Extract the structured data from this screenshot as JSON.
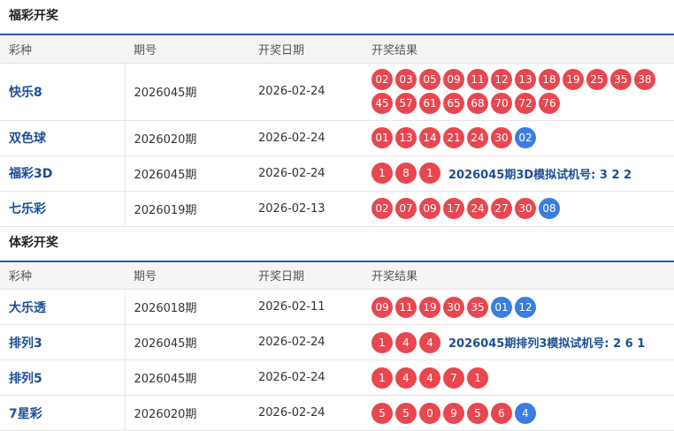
{
  "colors": {
    "red_ball": "#e8474f",
    "blue_ball": "#3a7ee0",
    "link": "#1d4e96",
    "header_border": "#2a5ba3"
  },
  "sections": [
    {
      "title": "福彩开奖",
      "headers": [
        "彩种",
        "期号",
        "开奖日期",
        "开奖结果"
      ],
      "rows": [
        {
          "name": "快乐8",
          "issue": "2026045期",
          "date": "2026-02-24",
          "balls": [
            {
              "n": "02",
              "c": "red"
            },
            {
              "n": "03",
              "c": "red"
            },
            {
              "n": "05",
              "c": "red"
            },
            {
              "n": "09",
              "c": "red"
            },
            {
              "n": "11",
              "c": "red"
            },
            {
              "n": "12",
              "c": "red"
            },
            {
              "n": "13",
              "c": "red"
            },
            {
              "n": "18",
              "c": "red"
            },
            {
              "n": "19",
              "c": "red"
            },
            {
              "n": "25",
              "c": "red"
            },
            {
              "n": "35",
              "c": "red"
            },
            {
              "n": "38",
              "c": "red"
            },
            {
              "n": "45",
              "c": "red"
            },
            {
              "n": "57",
              "c": "red"
            },
            {
              "n": "61",
              "c": "red"
            },
            {
              "n": "65",
              "c": "red"
            },
            {
              "n": "68",
              "c": "red"
            },
            {
              "n": "70",
              "c": "red"
            },
            {
              "n": "72",
              "c": "red"
            },
            {
              "n": "76",
              "c": "red"
            }
          ],
          "sim": ""
        },
        {
          "name": "双色球",
          "issue": "2026020期",
          "date": "2026-02-24",
          "balls": [
            {
              "n": "01",
              "c": "red"
            },
            {
              "n": "13",
              "c": "red"
            },
            {
              "n": "14",
              "c": "red"
            },
            {
              "n": "21",
              "c": "red"
            },
            {
              "n": "24",
              "c": "red"
            },
            {
              "n": "30",
              "c": "red"
            },
            {
              "n": "02",
              "c": "blue"
            }
          ],
          "sim": ""
        },
        {
          "name": "福彩3D",
          "issue": "2026045期",
          "date": "2026-02-24",
          "balls": [
            {
              "n": "1",
              "c": "red"
            },
            {
              "n": "8",
              "c": "red"
            },
            {
              "n": "1",
              "c": "red"
            }
          ],
          "sim": "2026045期3D模拟试机号: 3 2 2"
        },
        {
          "name": "七乐彩",
          "issue": "2026019期",
          "date": "2026-02-13",
          "balls": [
            {
              "n": "02",
              "c": "red"
            },
            {
              "n": "07",
              "c": "red"
            },
            {
              "n": "09",
              "c": "red"
            },
            {
              "n": "17",
              "c": "red"
            },
            {
              "n": "24",
              "c": "red"
            },
            {
              "n": "27",
              "c": "red"
            },
            {
              "n": "30",
              "c": "red"
            },
            {
              "n": "08",
              "c": "blue"
            }
          ],
          "sim": ""
        }
      ]
    },
    {
      "title": "体彩开奖",
      "headers": [
        "彩种",
        "期号",
        "开奖日期",
        "开奖结果"
      ],
      "rows": [
        {
          "name": "大乐透",
          "issue": "2026018期",
          "date": "2026-02-11",
          "balls": [
            {
              "n": "09",
              "c": "red"
            },
            {
              "n": "11",
              "c": "red"
            },
            {
              "n": "19",
              "c": "red"
            },
            {
              "n": "30",
              "c": "red"
            },
            {
              "n": "35",
              "c": "red"
            },
            {
              "n": "01",
              "c": "blue"
            },
            {
              "n": "12",
              "c": "blue"
            }
          ],
          "sim": ""
        },
        {
          "name": "排列3",
          "issue": "2026045期",
          "date": "2026-02-24",
          "balls": [
            {
              "n": "1",
              "c": "red"
            },
            {
              "n": "4",
              "c": "red"
            },
            {
              "n": "4",
              "c": "red"
            }
          ],
          "sim": "2026045期排列3模拟试机号: 2 6 1"
        },
        {
          "name": "排列5",
          "issue": "2026045期",
          "date": "2026-02-24",
          "balls": [
            {
              "n": "1",
              "c": "red"
            },
            {
              "n": "4",
              "c": "red"
            },
            {
              "n": "4",
              "c": "red"
            },
            {
              "n": "7",
              "c": "red"
            },
            {
              "n": "1",
              "c": "red"
            }
          ],
          "sim": ""
        },
        {
          "name": "7星彩",
          "issue": "2026020期",
          "date": "2026-02-24",
          "balls": [
            {
              "n": "5",
              "c": "red"
            },
            {
              "n": "5",
              "c": "red"
            },
            {
              "n": "0",
              "c": "red"
            },
            {
              "n": "9",
              "c": "red"
            },
            {
              "n": "5",
              "c": "red"
            },
            {
              "n": "6",
              "c": "red"
            },
            {
              "n": "4",
              "c": "blue"
            }
          ],
          "sim": ""
        }
      ]
    }
  ]
}
